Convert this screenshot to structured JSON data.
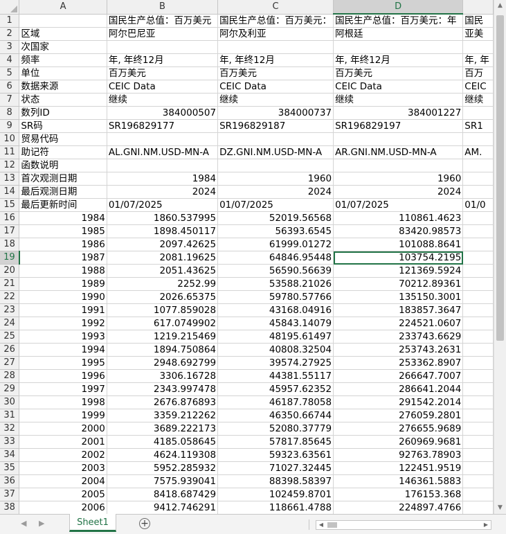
{
  "columns": [
    {
      "label": "A",
      "selected": false
    },
    {
      "label": "B",
      "selected": false
    },
    {
      "label": "C",
      "selected": false
    },
    {
      "label": "D",
      "selected": true
    },
    {
      "label": "",
      "selected": false
    }
  ],
  "rows": [
    {
      "n": "1",
      "cells": [
        "",
        "国民生产总值：百万美元",
        "国民生产总值：百万美元：",
        "国民生产总值：百万美元：年",
        "国民"
      ]
    },
    {
      "n": "2",
      "cells": [
        "区域",
        "阿尔巴尼亚",
        "阿尔及利亚",
        "阿根廷",
        "亚美"
      ]
    },
    {
      "n": "3",
      "cells": [
        "次国家",
        "",
        "",
        "",
        ""
      ]
    },
    {
      "n": "4",
      "cells": [
        "频率",
        "年, 年终12月",
        "年, 年终12月",
        "年, 年终12月",
        "年, 年"
      ]
    },
    {
      "n": "5",
      "cells": [
        "单位",
        "百万美元",
        "百万美元",
        "百万美元",
        "百万"
      ]
    },
    {
      "n": "6",
      "cells": [
        "数据来源",
        "CEIC Data",
        "CEIC Data",
        "CEIC Data",
        "CEIC"
      ]
    },
    {
      "n": "7",
      "cells": [
        "状态",
        "继续",
        "继续",
        "继续",
        "继续"
      ]
    },
    {
      "n": "8",
      "cells": [
        "数列ID",
        "384000507",
        "384000737",
        "384001227",
        ""
      ]
    },
    {
      "n": "9",
      "cells": [
        "SR码",
        "SR196829177",
        "SR196829187",
        "SR196829197",
        "SR1"
      ]
    },
    {
      "n": "10",
      "cells": [
        "贸易代码",
        "",
        "",
        "",
        ""
      ]
    },
    {
      "n": "11",
      "cells": [
        "助记符",
        "AL.GNI.NM.USD-MN-A",
        "DZ.GNI.NM.USD-MN-A",
        "AR.GNI.NM.USD-MN-A",
        "AM."
      ]
    },
    {
      "n": "12",
      "cells": [
        "函数说明",
        "",
        "",
        "",
        ""
      ]
    },
    {
      "n": "13",
      "cells": [
        "首次观测日期",
        "1984",
        "1960",
        "1960",
        ""
      ]
    },
    {
      "n": "14",
      "cells": [
        "最后观测日期",
        "2024",
        "2024",
        "2024",
        ""
      ]
    },
    {
      "n": "15",
      "cells": [
        "最后更新时间",
        "01/07/2025",
        "01/07/2025",
        "01/07/2025",
        "01/0"
      ]
    },
    {
      "n": "16",
      "cells": [
        "1984",
        "1860.537995",
        "52019.56568",
        "110861.4623",
        ""
      ]
    },
    {
      "n": "17",
      "cells": [
        "1985",
        "1898.450117",
        "56393.6545",
        "83420.98573",
        ""
      ]
    },
    {
      "n": "18",
      "cells": [
        "1986",
        "2097.42625",
        "61999.01272",
        "101088.8641",
        ""
      ]
    },
    {
      "n": "19",
      "cells": [
        "1987",
        "2081.19625",
        "64846.95448",
        "103754.2195",
        ""
      ]
    },
    {
      "n": "20",
      "cells": [
        "1988",
        "2051.43625",
        "56590.56639",
        "121369.5924",
        ""
      ]
    },
    {
      "n": "21",
      "cells": [
        "1989",
        "2252.99",
        "53588.21026",
        "70212.89361",
        ""
      ]
    },
    {
      "n": "22",
      "cells": [
        "1990",
        "2026.65375",
        "59780.57766",
        "135150.3001",
        ""
      ]
    },
    {
      "n": "23",
      "cells": [
        "1991",
        "1077.859028",
        "43168.04916",
        "183857.3647",
        ""
      ]
    },
    {
      "n": "24",
      "cells": [
        "1992",
        "617.0749902",
        "45843.14079",
        "224521.0607",
        ""
      ]
    },
    {
      "n": "25",
      "cells": [
        "1993",
        "1219.215469",
        "48195.61497",
        "233743.6629",
        ""
      ]
    },
    {
      "n": "26",
      "cells": [
        "1994",
        "1894.750864",
        "40808.32504",
        "253743.2631",
        ""
      ]
    },
    {
      "n": "27",
      "cells": [
        "1995",
        "2948.692799",
        "39574.27925",
        "253362.8907",
        ""
      ]
    },
    {
      "n": "28",
      "cells": [
        "1996",
        "3306.16728",
        "44381.55117",
        "266647.7007",
        ""
      ]
    },
    {
      "n": "29",
      "cells": [
        "1997",
        "2343.997478",
        "45957.62352",
        "286641.2044",
        ""
      ]
    },
    {
      "n": "30",
      "cells": [
        "1998",
        "2676.876893",
        "46187.78058",
        "291542.2014",
        ""
      ]
    },
    {
      "n": "31",
      "cells": [
        "1999",
        "3359.212262",
        "46350.66744",
        "276059.2801",
        ""
      ]
    },
    {
      "n": "32",
      "cells": [
        "2000",
        "3689.222173",
        "52080.37779",
        "276655.9689",
        ""
      ]
    },
    {
      "n": "33",
      "cells": [
        "2001",
        "4185.058645",
        "57817.85645",
        "260969.9681",
        ""
      ]
    },
    {
      "n": "34",
      "cells": [
        "2002",
        "4624.119308",
        "59323.63561",
        "92763.78903",
        ""
      ]
    },
    {
      "n": "35",
      "cells": [
        "2003",
        "5952.285932",
        "71027.32445",
        "122451.9519",
        ""
      ]
    },
    {
      "n": "36",
      "cells": [
        "2004",
        "7575.939041",
        "88398.58397",
        "146361.5883",
        ""
      ]
    },
    {
      "n": "37",
      "cells": [
        "2005",
        "8418.687429",
        "102459.8701",
        "176153.368",
        ""
      ]
    },
    {
      "n": "38",
      "cells": [
        "2006",
        "9412.746291",
        "118661.4788",
        "224897.4766",
        ""
      ]
    }
  ],
  "active_cell": {
    "row": "19",
    "col": "D"
  },
  "sheet_tab": "Sheet1",
  "add_sheet_symbol": "+",
  "colors": {
    "accent": "#217346",
    "header_bg": "#f0f0f0",
    "grid": "#d4d4d4"
  }
}
